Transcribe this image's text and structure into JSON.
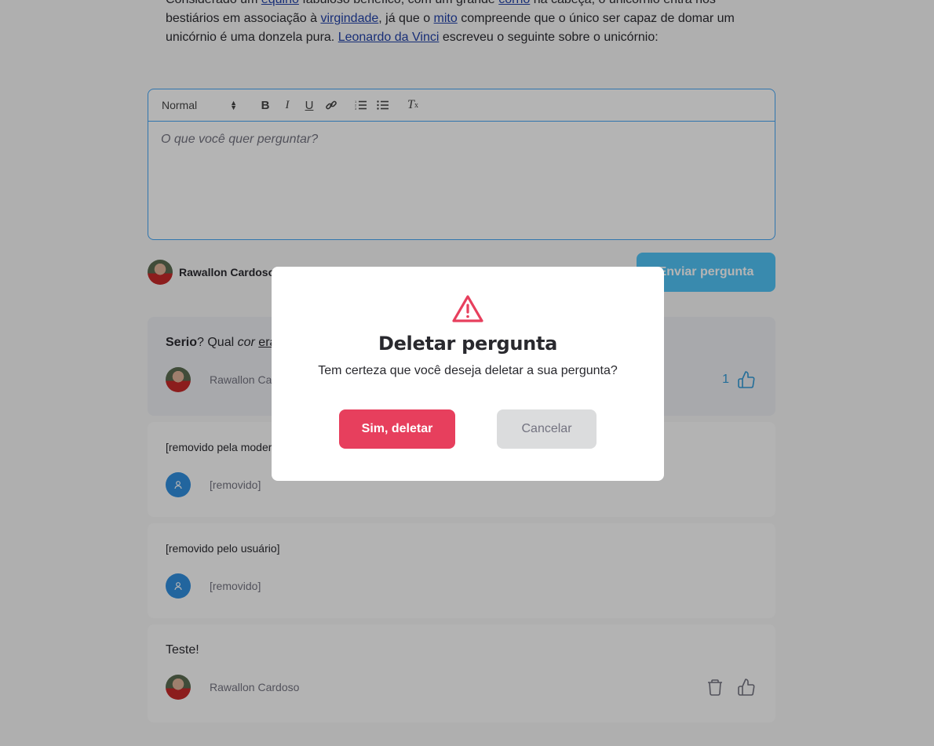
{
  "intro": {
    "line1_pre": "Considerado um ",
    "link_equino": "equino",
    "line1_mid": " fabuloso benéfico, com um grande ",
    "link_corno": "corno",
    "line1_post": " na cabeça, o unicórnio entra nos",
    "line2_pre": "bestiários em associação à ",
    "link_virgindade": "virgindade",
    "line2_mid": ", já que o ",
    "link_mito": "mito",
    "line2_post": " compreende que o único ser capaz de domar um",
    "line3_pre": "unicórnio é uma donzela pura. ",
    "link_davinci": "Leonardo da Vinci",
    "line3_post": " escreveu o seguinte sobre o unicórnio:"
  },
  "editor": {
    "format_select": "Normal",
    "placeholder": "O que você quer perguntar?",
    "tools": [
      "bold-icon",
      "italic-icon",
      "underline-icon",
      "link-icon",
      "ordered-list-icon",
      "bullet-list-icon",
      "clear-format-icon"
    ]
  },
  "author": {
    "name": "Rawallon Cardoso",
    "send_label": "Enviar pergunta"
  },
  "questions": [
    {
      "bold": "Serio",
      "text": "? Qual ",
      "italic": "cor",
      "underline": "era",
      "author": "Rawallon Cardoso",
      "likes": "1"
    },
    {
      "text": "[removido pela moderação]",
      "author": "[removido]"
    },
    {
      "text": "[removido pelo usuário]",
      "author": "[removido]"
    },
    {
      "text": "Teste!",
      "author": "Rawallon Cardoso"
    }
  ],
  "modal": {
    "title": "Deletar pergunta",
    "message": "Tem certeza que você deseja deletar a sua pergunta?",
    "confirm_label": "Sim, deletar",
    "cancel_label": "Cancelar"
  },
  "colors": {
    "accent": "#4fc3f7",
    "danger": "#e73f5d",
    "link": "#1f3fa8"
  }
}
